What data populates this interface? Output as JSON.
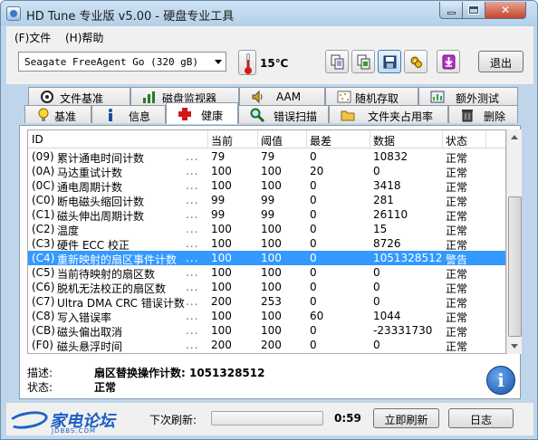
{
  "window": {
    "title": "HD Tune 专业版 v5.00 - 硬盘专业工具"
  },
  "menu": {
    "file": "(F)文件",
    "help": "(H)帮助"
  },
  "toolbar": {
    "drive": "Seagate FreeAgent Go    (320 gB)",
    "temperature": "15℃",
    "exit_label": "退出",
    "tool_icons": [
      "copy-text-icon",
      "copy-screen-icon",
      "save-icon",
      "options-icon",
      "download-icon"
    ]
  },
  "tabs_top": [
    "文件基准",
    "磁盘监视器",
    "AAM",
    "随机存取",
    "额外测试"
  ],
  "tabs_bottom": [
    "基准",
    "信息",
    "健康",
    "错误扫描",
    "文件夹占用率",
    "删除"
  ],
  "selected_tab": "健康",
  "table": {
    "headers": [
      "ID",
      "当前",
      "阈值",
      "最差",
      "数据",
      "状态"
    ],
    "rows": [
      {
        "id": "(09)",
        "name": "累计通电时间计数",
        "dots": "...",
        "current": "79",
        "threshold": "79",
        "worst": "0",
        "data": "10832",
        "status": "正常"
      },
      {
        "id": "(0A)",
        "name": "马达重试计数",
        "dots": "...",
        "current": "100",
        "threshold": "100",
        "worst": "20",
        "data": "0",
        "status": "正常"
      },
      {
        "id": "(0C)",
        "name": "通电周期计数",
        "dots": "...",
        "current": "100",
        "threshold": "100",
        "worst": "0",
        "data": "3418",
        "status": "正常"
      },
      {
        "id": "(C0)",
        "name": "断电磁头缩回计数",
        "dots": "...",
        "current": "99",
        "threshold": "99",
        "worst": "0",
        "data": "281",
        "status": "正常"
      },
      {
        "id": "(C1)",
        "name": "磁头伸出周期计数",
        "dots": "...",
        "current": "99",
        "threshold": "99",
        "worst": "0",
        "data": "26110",
        "status": "正常"
      },
      {
        "id": "(C2)",
        "name": "温度",
        "dots": "...",
        "current": "100",
        "threshold": "100",
        "worst": "0",
        "data": "15",
        "status": "正常"
      },
      {
        "id": "(C3)",
        "name": "硬件 ECC 校正",
        "dots": "...",
        "current": "100",
        "threshold": "100",
        "worst": "0",
        "data": "8726",
        "status": "正常"
      },
      {
        "id": "(C4)",
        "name": "重新映射的扇区事件计数",
        "dots": "...",
        "current": "100",
        "threshold": "100",
        "worst": "0",
        "data": "1051328512",
        "status": "警告"
      },
      {
        "id": "(C5)",
        "name": "当前待映射的扇区数",
        "dots": "...",
        "current": "100",
        "threshold": "100",
        "worst": "0",
        "data": "0",
        "status": "正常"
      },
      {
        "id": "(C6)",
        "name": "脱机无法校正的扇区数",
        "dots": "...",
        "current": "100",
        "threshold": "100",
        "worst": "0",
        "data": "0",
        "status": "正常"
      },
      {
        "id": "(C7)",
        "name": "Ultra DMA CRC 错误计数",
        "dots": "...",
        "current": "200",
        "threshold": "253",
        "worst": "0",
        "data": "0",
        "status": "正常"
      },
      {
        "id": "(C8)",
        "name": "写入错误率",
        "dots": "...",
        "current": "100",
        "threshold": "100",
        "worst": "60",
        "data": "1044",
        "status": "正常"
      },
      {
        "id": "(CB)",
        "name": "磁头偏出取消",
        "dots": "...",
        "current": "100",
        "threshold": "100",
        "worst": "0",
        "data": "-23331730",
        "status": "正常"
      },
      {
        "id": "(F0)",
        "name": "磁头悬浮时间",
        "dots": "...",
        "current": "200",
        "threshold": "200",
        "worst": "0",
        "data": "0",
        "status": "正常"
      }
    ],
    "selected_row_index": 7
  },
  "details": {
    "desc_label": "描述:",
    "desc_value": "扇区替换操作计数: 1051328512",
    "status_label": "状态:",
    "status_value": "正常"
  },
  "statusbar": {
    "logo_text": "家电论坛",
    "logo_domain": "JDBBS.COM",
    "next_refresh_label": "下次刷新:",
    "progress_fraction": 0.0,
    "countdown": "0:59",
    "refresh_now_label": "立即刷新",
    "log_label": "日志"
  },
  "colors": {
    "selection": "#3399ff",
    "window_frame": "#bfd6ea",
    "close_button": "#c5442b"
  }
}
